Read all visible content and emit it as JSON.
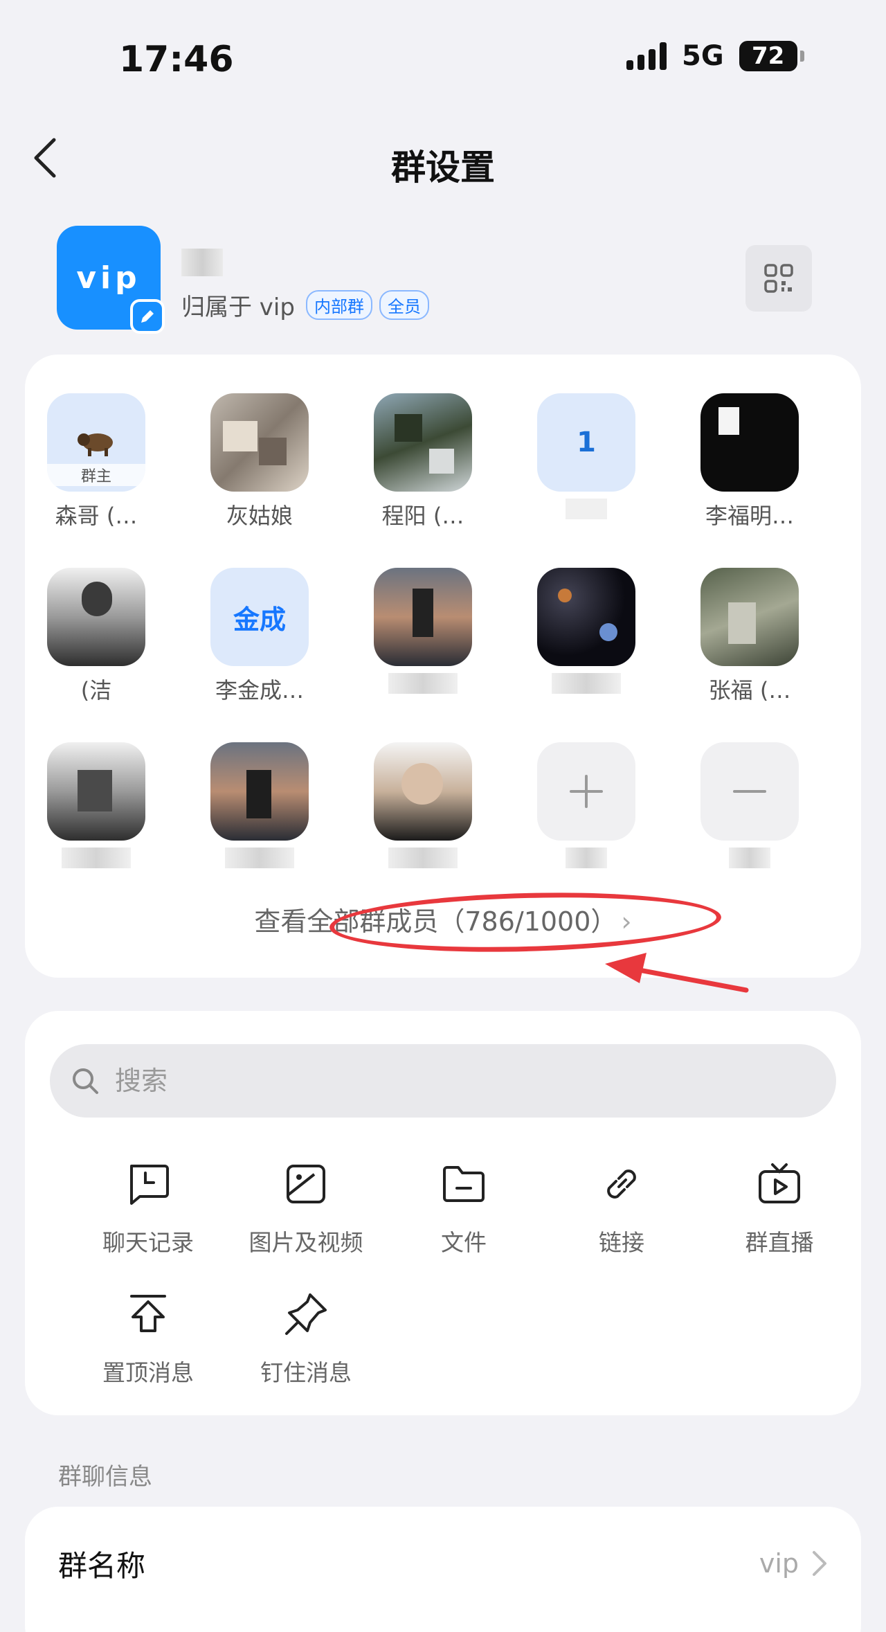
{
  "status_bar": {
    "time": "17:46",
    "network": "5G",
    "battery": "72"
  },
  "nav": {
    "title": "群设置"
  },
  "group": {
    "avatar_text": "vip",
    "name": "vip",
    "owner_text": "归属于 vip",
    "tags": [
      "内部群",
      "全员"
    ]
  },
  "members": {
    "items": [
      {
        "name": "森哥 (…",
        "avatar_label": "群主"
      },
      {
        "name": "灰姑娘"
      },
      {
        "name": "程阳 (…"
      },
      {
        "name": "",
        "avatar_label": "1"
      },
      {
        "name": "李福明…"
      },
      {
        "name": "(洁"
      },
      {
        "name": "李金成…",
        "avatar_label": "金成"
      },
      {
        "name": ""
      },
      {
        "name": ""
      },
      {
        "name": "张福 (…"
      },
      {
        "name": ""
      },
      {
        "name": ""
      },
      {
        "name": ""
      }
    ],
    "view_all": "查看全部群成员（786/1000）"
  },
  "search": {
    "placeholder": "搜索"
  },
  "tools": [
    {
      "label": "聊天记录",
      "icon": "chat-history-icon"
    },
    {
      "label": "图片及视频",
      "icon": "image-icon"
    },
    {
      "label": "文件",
      "icon": "folder-icon"
    },
    {
      "label": "链接",
      "icon": "link-icon"
    },
    {
      "label": "群直播",
      "icon": "live-tv-icon"
    },
    {
      "label": "置顶消息",
      "icon": "pin-top-icon"
    },
    {
      "label": "钉住消息",
      "icon": "pushpin-icon"
    }
  ],
  "info": {
    "section_title": "群聊信息",
    "group_name_label": "群名称",
    "group_name_value": "vip"
  },
  "colors": {
    "accent": "#1890ff",
    "annotation": "#e8383d",
    "background": "#f2f2f6"
  }
}
